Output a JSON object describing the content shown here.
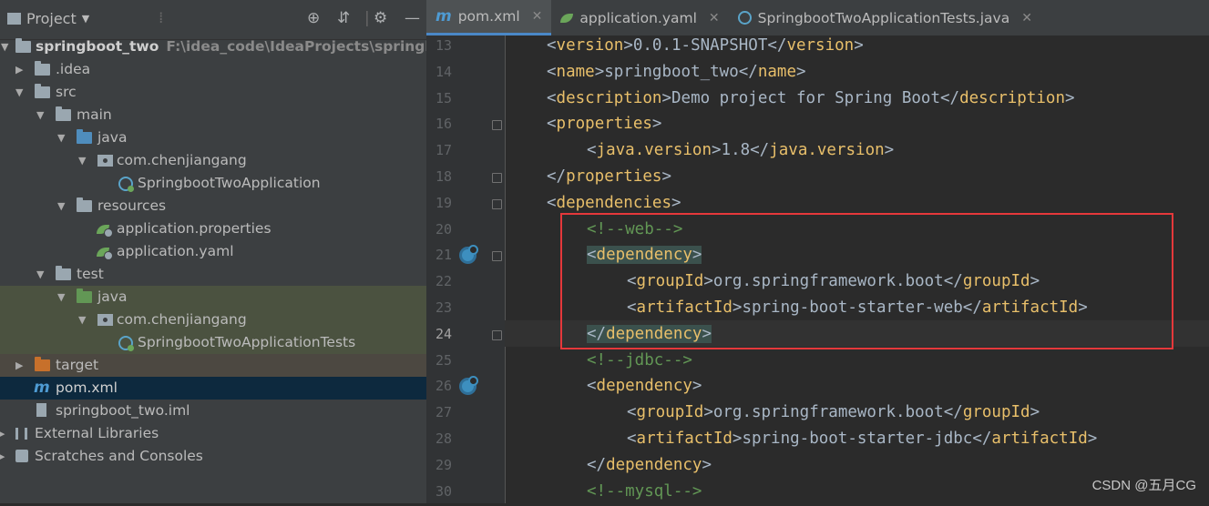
{
  "project_panel": {
    "title": "Project",
    "tree": [
      {
        "label": "springboot_two",
        "path": "F:\\idea_code\\IdeaProjects\\springboot_two",
        "icon": "module-folder-icon"
      },
      {
        "label": ".idea",
        "icon": "folder-icon"
      },
      {
        "label": "src",
        "icon": "folder-icon"
      },
      {
        "label": "main",
        "icon": "folder-icon"
      },
      {
        "label": "java",
        "icon": "source-folder-icon"
      },
      {
        "label": "com.chenjiangang",
        "icon": "package-icon"
      },
      {
        "label": "SpringbootTwoApplication",
        "icon": "spring-boot-class-icon"
      },
      {
        "label": "resources",
        "icon": "resources-folder-icon"
      },
      {
        "label": "application.properties",
        "icon": "spring-config-icon"
      },
      {
        "label": "application.yaml",
        "icon": "spring-config-icon"
      },
      {
        "label": "test",
        "icon": "folder-icon"
      },
      {
        "label": "java",
        "icon": "test-folder-icon"
      },
      {
        "label": "com.chenjiangang",
        "icon": "package-icon"
      },
      {
        "label": "SpringbootTwoApplicationTests",
        "icon": "spring-boot-class-icon"
      },
      {
        "label": "target",
        "icon": "excluded-folder-icon"
      },
      {
        "label": "pom.xml",
        "icon": "maven-icon"
      },
      {
        "label": "springboot_two.iml",
        "icon": "iml-file-icon"
      },
      {
        "label": "External Libraries",
        "icon": "library-icon"
      },
      {
        "label": "Scratches and Consoles",
        "icon": "scratch-icon"
      }
    ]
  },
  "tabs": [
    {
      "label": "pom.xml",
      "icon": "maven-icon",
      "active": true
    },
    {
      "label": "application.yaml",
      "icon": "spring-config-icon",
      "active": false
    },
    {
      "label": "SpringbootTwoApplicationTests.java",
      "icon": "spring-boot-class-icon",
      "active": false
    }
  ],
  "editor": {
    "lines": [
      {
        "n": "13",
        "text": "<version>0.0.1-SNAPSHOT</version>"
      },
      {
        "n": "14",
        "text": "<name>springboot_two</name>"
      },
      {
        "n": "15",
        "text": "<description>Demo project for Spring Boot</description>"
      },
      {
        "n": "16",
        "text": "<properties>"
      },
      {
        "n": "17",
        "text": "<java.version>1.8</java.version>"
      },
      {
        "n": "18",
        "text": "</properties>"
      },
      {
        "n": "19",
        "text": "<dependencies>"
      },
      {
        "n": "20",
        "text": "<!--web-->"
      },
      {
        "n": "21",
        "text": "<dependency>"
      },
      {
        "n": "22",
        "text": "<groupId>org.springframework.boot</groupId>"
      },
      {
        "n": "23",
        "text": "<artifactId>spring-boot-starter-web</artifactId>"
      },
      {
        "n": "24",
        "text": "</dependency>"
      },
      {
        "n": "25",
        "text": "<!--jdbc-->"
      },
      {
        "n": "26",
        "text": "<dependency>"
      },
      {
        "n": "27",
        "text": "<groupId>org.springframework.boot</groupId>"
      },
      {
        "n": "28",
        "text": "<artifactId>spring-boot-starter-jdbc</artifactId>"
      },
      {
        "n": "29",
        "text": "</dependency>"
      },
      {
        "n": "30",
        "text": "<!--mysql-->"
      }
    ]
  },
  "watermark": "CSDN @五月CG",
  "colors": {
    "tag": "#e8bf6a",
    "text": "#a9b7c6",
    "comment": "#629755",
    "highlight_box": "#e5383b",
    "selection": "#0d293e"
  }
}
